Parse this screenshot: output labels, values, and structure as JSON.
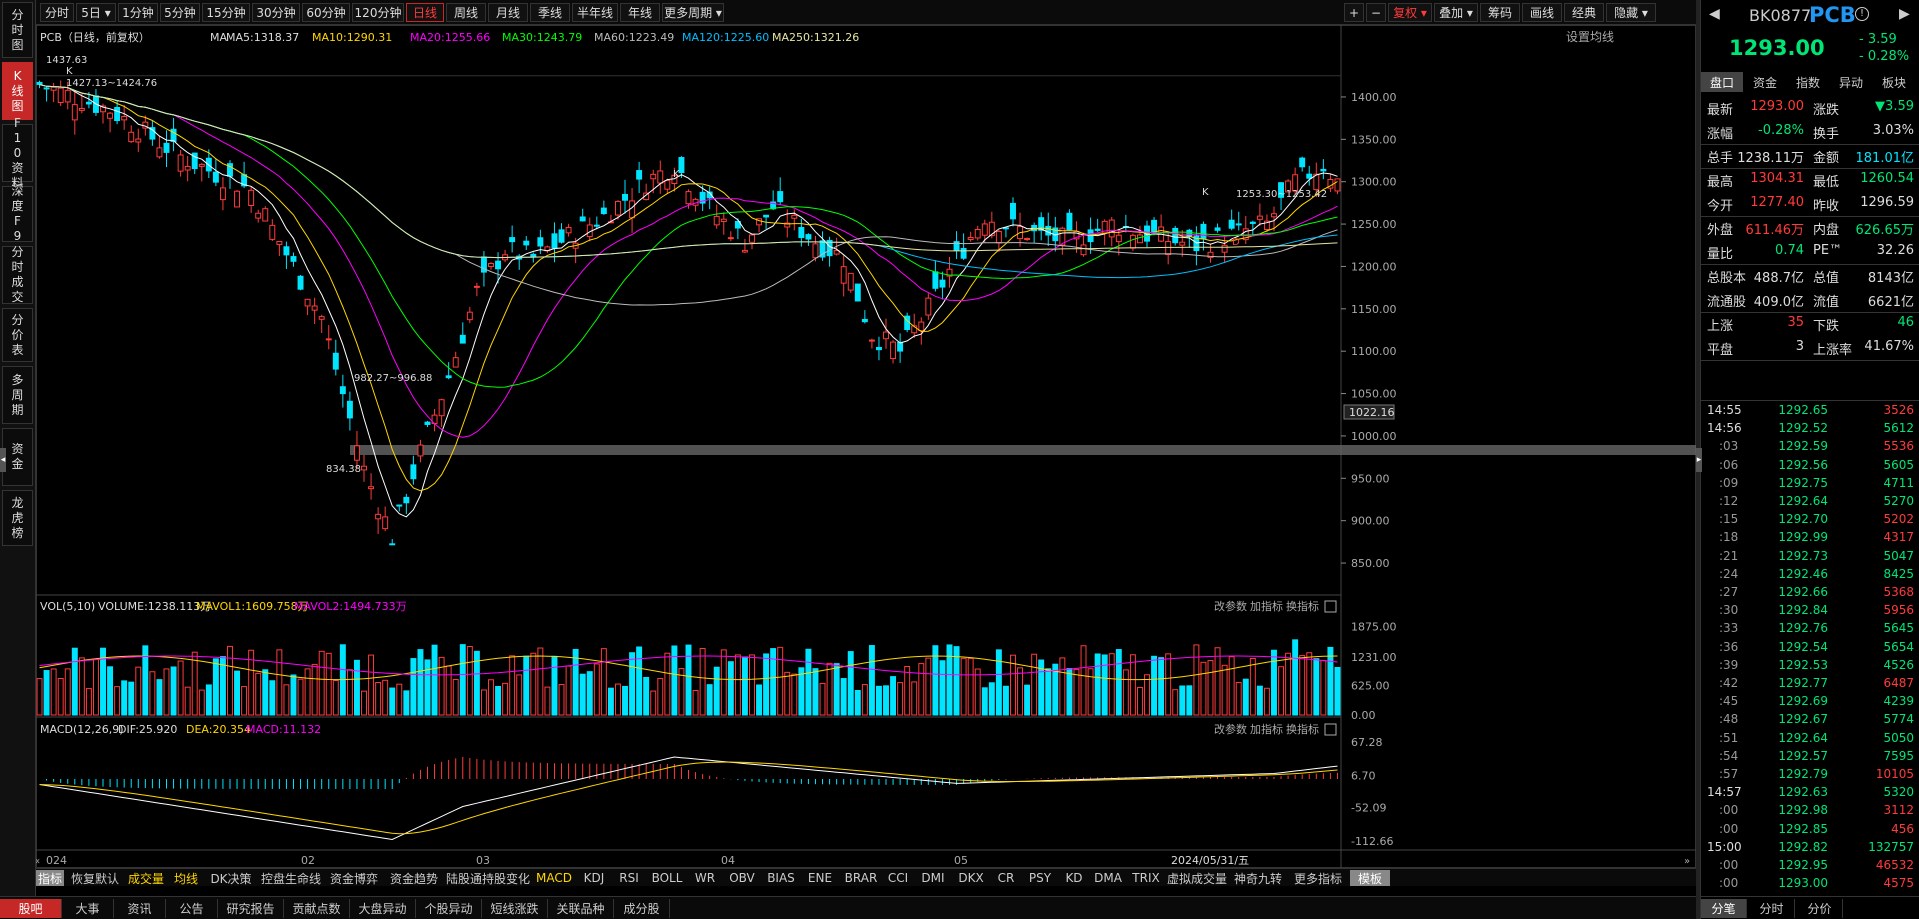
{
  "left_nav": [
    "分时图",
    "K线图",
    "F10资料",
    "深度F9",
    "分时成交",
    "分价表",
    "多周期",
    "资金",
    "龙虎榜"
  ],
  "period_bar": {
    "items": [
      "分时",
      "5日",
      "1分钟",
      "5分钟",
      "15分钟",
      "30分钟",
      "60分钟",
      "120分钟",
      "日线",
      "周线",
      "月线",
      "季线",
      "半年线",
      "年线",
      "更多周期"
    ],
    "active": "日线",
    "right": [
      "+",
      "−",
      "复权",
      "叠加",
      "筹码",
      "画线",
      "经典",
      "隐藏"
    ]
  },
  "price_chart": {
    "legend": [
      "PCB（日线，前复权）",
      "MA",
      "MA5:1318.37",
      "MA10:1290.31",
      "MA20:1255.66",
      "MA30:1243.79",
      "MA60:1223.49",
      "MA120:1225.60",
      "MA250:1321.26"
    ],
    "settings_label": "设置均线",
    "y_ticks": [
      "1400.00",
      "1350.00",
      "1300.00",
      "1250.00",
      "1200.00",
      "1150.00",
      "1100.00",
      "1050.00",
      "1000.00",
      "950.00",
      "900.00",
      "850.00"
    ],
    "y_min": 830,
    "y_max": 1420,
    "current_price_tag": "1022.16",
    "annotations": [
      "1437.63",
      "1427.13~1424.76",
      "834.38",
      "982.27~996.88",
      "1253.30~1253.42"
    ],
    "marks": [
      "K",
      "K",
      "K",
      "D",
      "D"
    ],
    "x_labels": [
      "024",
      "02",
      "03",
      "04",
      "05",
      "2024/05/31/五"
    ]
  },
  "volume_chart": {
    "legend": [
      "VOL(5,10)",
      "VOLUME:1238.113万",
      "MAVOL1:1609.758万",
      "MAVOL2:1494.733万"
    ],
    "y_ticks": [
      "1875.00",
      "1231.00",
      "625.00",
      "0.00"
    ],
    "actions": [
      "改参数",
      "加指标",
      "换指标"
    ]
  },
  "macd_chart": {
    "legend": [
      "MACD(12,26,9)",
      "DIF:25.920",
      "DEA:20.354",
      "MACD:11.132"
    ],
    "y_ticks": [
      "67.28",
      "6.70",
      "-52.09",
      "-112.66"
    ],
    "actions": [
      "改参数",
      "加指标",
      "换指标"
    ]
  },
  "indicator_tabs": [
    "指标",
    "恢复默认",
    "成交量",
    "均线",
    "DK决策",
    "控盘生命线",
    "资金博弈",
    "资金趋势",
    "陆股通持股变化",
    "MACD",
    "KDJ",
    "RSI",
    "BOLL",
    "WR",
    "OBV",
    "BIAS",
    "ENE",
    "BRAR",
    "CCI",
    "DMI",
    "DKX",
    "CR",
    "PSY",
    "KD",
    "DMA",
    "TRIX",
    "虚拟成交量",
    "神奇九转",
    "更多指标",
    "模板"
  ],
  "bottom_tabs": [
    "股吧",
    "大事",
    "资讯",
    "公告",
    "研究报告",
    "贡献点数",
    "大盘异动",
    "个股异动",
    "短线涨跌",
    "关联品种",
    "成分股"
  ],
  "quote": {
    "code": "BK0877",
    "name": "PCB",
    "price": "1293.00",
    "change": "- 3.59",
    "change_pct": "- 0.28%",
    "tabs": [
      "盘口",
      "资金",
      "指数",
      "异动",
      "板块"
    ],
    "rows": [
      [
        "最新",
        "1293.00",
        "涨跌",
        "▼3.59"
      ],
      [
        "涨幅",
        "-0.28%",
        "换手",
        "3.03%"
      ],
      [
        "总手",
        "1238.11万",
        "金额",
        "181.01亿"
      ],
      [
        "最高",
        "1304.31",
        "最低",
        "1260.54"
      ],
      [
        "今开",
        "1277.40",
        "昨收",
        "1296.59"
      ],
      [
        "外盘",
        "611.46万",
        "内盘",
        "626.65万"
      ],
      [
        "量比",
        "0.74",
        "PE™",
        "32.26"
      ],
      [
        "总股本",
        "488.7亿",
        "总值",
        "8143亿"
      ],
      [
        "流通股",
        "409.0亿",
        "流值",
        "6621亿"
      ],
      [
        "上涨",
        "35",
        "下跌",
        "46"
      ],
      [
        "平盘",
        "3",
        "上涨率",
        "41.67%"
      ]
    ]
  },
  "ticks": [
    [
      "14:55",
      "1292.65",
      "3526"
    ],
    [
      "14:56",
      "1292.52",
      "5612"
    ],
    [
      ":03",
      "1292.59",
      "5536"
    ],
    [
      ":06",
      "1292.56",
      "5605"
    ],
    [
      ":09",
      "1292.75",
      "4711"
    ],
    [
      ":12",
      "1292.64",
      "5270"
    ],
    [
      ":15",
      "1292.70",
      "5202"
    ],
    [
      ":18",
      "1292.99",
      "4317"
    ],
    [
      ":21",
      "1292.73",
      "5047"
    ],
    [
      ":24",
      "1292.46",
      "8425"
    ],
    [
      ":27",
      "1292.66",
      "5368"
    ],
    [
      ":30",
      "1292.84",
      "5956"
    ],
    [
      ":33",
      "1292.76",
      "5645"
    ],
    [
      ":36",
      "1292.54",
      "5654"
    ],
    [
      ":39",
      "1292.53",
      "4526"
    ],
    [
      ":42",
      "1292.77",
      "6487"
    ],
    [
      ":45",
      "1292.69",
      "4239"
    ],
    [
      ":48",
      "1292.67",
      "5774"
    ],
    [
      ":51",
      "1292.64",
      "5050"
    ],
    [
      ":54",
      "1292.57",
      "7595"
    ],
    [
      ":57",
      "1292.79",
      "10105"
    ],
    [
      "14:57",
      "1292.63",
      "5320"
    ],
    [
      ":00",
      "1292.98",
      "3112"
    ],
    [
      ":00",
      "1292.85",
      "456"
    ],
    [
      "15:00",
      "1292.82",
      "132757"
    ],
    [
      ":00",
      "1292.95",
      "46532"
    ],
    [
      ":00",
      "1293.00",
      "4575"
    ]
  ],
  "tick_tabs": [
    "分笔",
    "分时",
    "分价"
  ],
  "colors": {
    "up": "#ff3b3b",
    "down": "#00e5ff",
    "ma5": "#ffffff",
    "ma10": "#ffd700",
    "ma20": "#ff00ff",
    "ma30": "#00ff00",
    "ma60": "#bbbbbb",
    "ma120": "#00bfff",
    "ma250": "#e6e6a0"
  }
}
